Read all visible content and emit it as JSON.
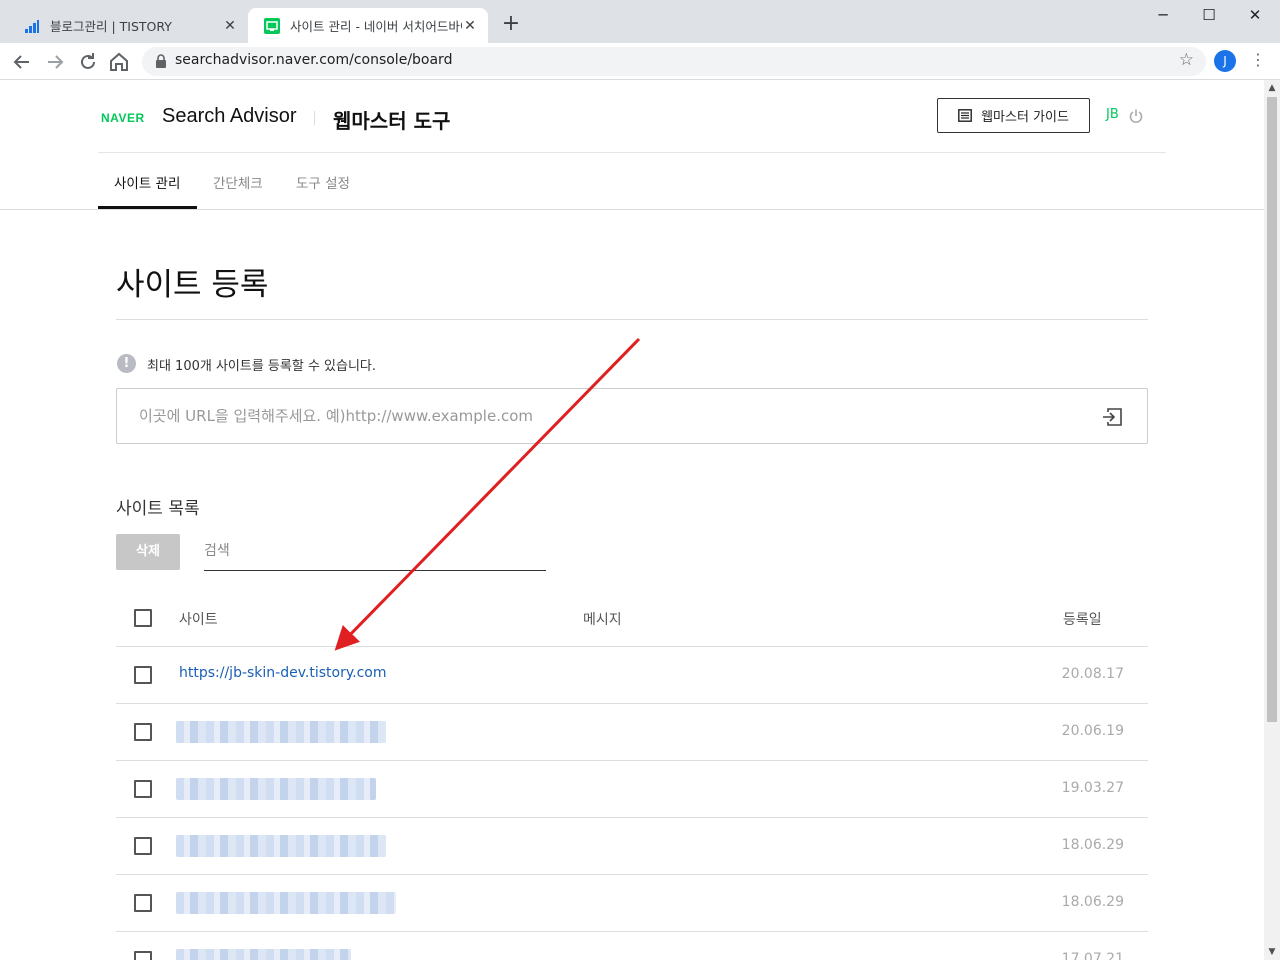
{
  "browser": {
    "tabs": [
      {
        "title": "블로그관리 | TISTORY",
        "close": "✕"
      },
      {
        "title": "사이트 관리 - 네이버 서치어드바이저",
        "close": "✕"
      }
    ],
    "new_tab": "+",
    "window_controls": {
      "minimize": "─",
      "maximize": "☐",
      "close": "✕"
    },
    "url": "searchadvisor.naver.com/console/board",
    "profile_initial": "J"
  },
  "header": {
    "naver": "NAVER",
    "product": "Search Advisor",
    "section": "웹마스터 도구",
    "guide_button": "웹마스터 가이드",
    "user": "JB"
  },
  "gnb": {
    "items": [
      "사이트 관리",
      "간단체크",
      "도구 설정"
    ],
    "active_index": 0
  },
  "main": {
    "title": "사이트 등록",
    "notice": "최대 100개 사이트를 등록할 수 있습니다.",
    "notice_icon": "!",
    "url_placeholder": "이곳에 URL을 입력해주세요. 예)http://www.example.com",
    "list_title": "사이트 목록",
    "delete_button": "삭제",
    "search_placeholder": "검색"
  },
  "table": {
    "columns": [
      "사이트",
      "메시지",
      "등록일"
    ],
    "rows": [
      {
        "site": "https://jb-skin-dev.tistory.com",
        "blurred": false,
        "date": "20.08.17"
      },
      {
        "site": "",
        "blurred": true,
        "date": "20.06.19"
      },
      {
        "site": "",
        "blurred": true,
        "date": "19.03.27"
      },
      {
        "site": "",
        "blurred": true,
        "date": "18.06.29"
      },
      {
        "site": "",
        "blurred": true,
        "date": "18.06.29"
      },
      {
        "site": "",
        "blurred": true,
        "date": "17.07.21"
      }
    ]
  },
  "colors": {
    "naver_green": "#03c75a",
    "link_blue": "#1a5fb4",
    "annotation_arrow": "#e02020"
  }
}
